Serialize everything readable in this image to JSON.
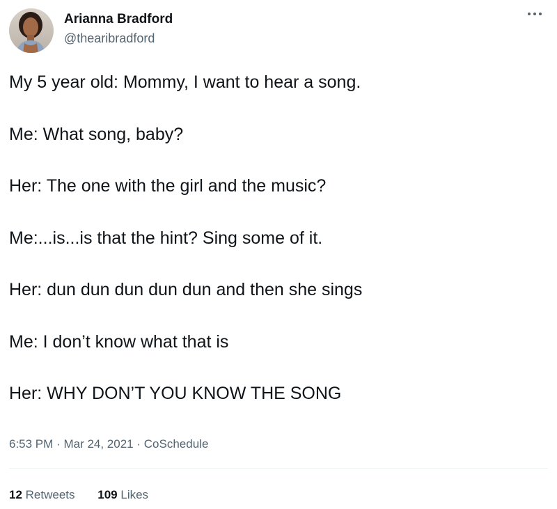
{
  "author": {
    "display_name": "Arianna Bradford",
    "handle": "@thearibradford",
    "avatar_icon": "profile-photo"
  },
  "tweet": {
    "lines": [
      "My 5 year old: Mommy, I want to hear a song.",
      "Me: What song, baby?",
      "Her: The one with the girl and the music?",
      "Me:...is...is that the hint? Sing some of it.",
      "Her: dun dun dun dun dun and then she sings",
      "Me: I don’t know what that is",
      "Her: WHY DON’T YOU KNOW THE SONG"
    ]
  },
  "meta": {
    "time": "6:53 PM",
    "separator": "·",
    "date": "Mar 24, 2021",
    "source": "CoSchedule"
  },
  "stats": {
    "retweets_count": "12",
    "retweets_label": "Retweets",
    "likes_count": "109",
    "likes_label": "Likes"
  },
  "colors": {
    "text_primary": "#0f1419",
    "text_secondary": "#536471",
    "divider": "#eff3f4"
  },
  "more_icon": "more-horizontal-icon"
}
